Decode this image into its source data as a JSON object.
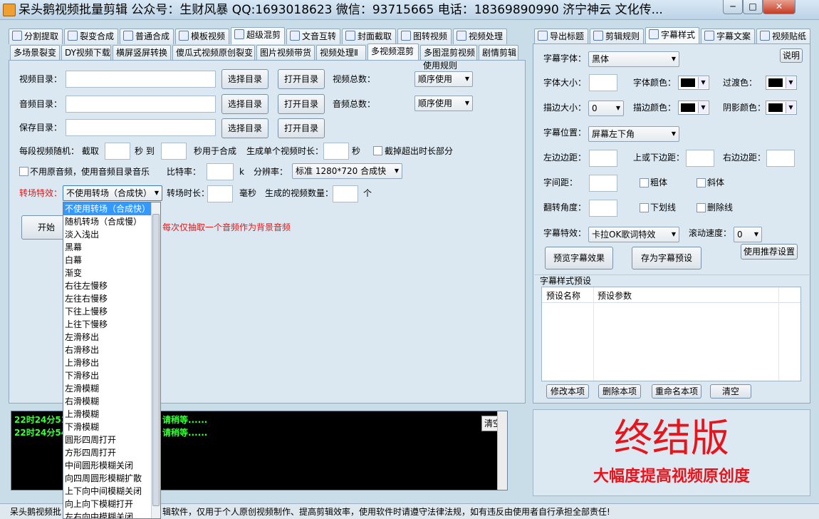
{
  "window": {
    "title": "呆头鹅视频批量剪辑 公众号：生财风暴 QQ:1693018623 微信：93715665 电话：18369890990 济宁神云 文化传...",
    "min_label": "─",
    "max_label": "□",
    "close_label": "✕"
  },
  "main_tabs": [
    "分割提取",
    "裂变合成",
    "普通合成",
    "模板视频",
    "超级混剪",
    "文音互转",
    "封面截取",
    "图转视频",
    "视频处理"
  ],
  "sub_tabs": [
    "多场景裂变",
    "DY视频下载",
    "横屏竖屏转换",
    "傻瓜式视频原创裂变",
    "图片视频带货",
    "视频处理Ⅱ",
    "多视频混剪",
    "多图混剪视频",
    "剧情剪辑"
  ],
  "form": {
    "usage_rule_label": "使用规则",
    "video_dir_label": "视频目录：",
    "audio_dir_label": "音频目录：",
    "save_dir_label": "保存目录：",
    "select_dir": "选择目录",
    "open_dir": "打开目录",
    "video_total_label": "视频总数：",
    "audio_total_label": "音频总数：",
    "video_order": "顺序使用",
    "audio_order": "顺序使用",
    "random_label": "每段视频随机： 截取",
    "sec_to": "秒 到",
    "sec_for_merge": "秒用于合成",
    "single_duration_label": "生成单个视频时长：",
    "sec": "秒",
    "cut_excess_label": "截掉超出时长部分",
    "no_original_audio": "不用原音频，使用音频目录音乐",
    "bitrate_label": "比特率：",
    "bitrate_unit": "k",
    "resolution_label": "分辨率：",
    "resolution_value": "标准 1280*720 合成快",
    "transition_label": "转场特效：",
    "transition_value": "不使用转场（合成快）",
    "transition_duration_label": "转场时长：",
    "ms": "毫秒",
    "gen_count_label": "生成的视频数量：",
    "unit_ge": "个",
    "start_btn": "开始",
    "hint_text": "每次仅抽取一个音频作为背景音频"
  },
  "transition_options": [
    "不使用转场（合成快）",
    "随机转场（合成慢）",
    "淡入浅出",
    "黑幕",
    "白幕",
    "渐变",
    "右往左慢移",
    "左往右慢移",
    "下往上慢移",
    "上往下慢移",
    "左滑移出",
    "右滑移出",
    "上滑移出",
    "下滑移出",
    "左滑模糊",
    "右滑模糊",
    "上滑模糊",
    "下滑模糊",
    "圆形四周打开",
    "方形四周打开",
    "中间圆形模糊关闭",
    "向四周圆形模糊扩散",
    "上下向中间模糊关闭",
    "向上向下模糊打开",
    "左右向中模糊关闭"
  ],
  "log": {
    "line1_time": "22时24分51",
    "line1_tail": "请稍等......",
    "line2_time": "22时24分54",
    "line2_tail": "请稍等......",
    "clear_btn": "清空"
  },
  "status": {
    "text": "呆头鹅视频批",
    "text_tail": "辑软件，仅用于个人原创视频制作、提高剪辑效率，使用软件时请遵守法律法规，如有违反由使用者自行承担全部责任!"
  },
  "right_tabs": [
    "导出标题",
    "剪辑规则",
    "字幕样式",
    "字幕文案",
    "视频贴纸"
  ],
  "subtitle": {
    "help_btn": "说明",
    "font_label": "字幕字体：",
    "font_value": "黑体",
    "size_label": "字体大小：",
    "font_color_label": "字体颜色：",
    "transition_color_label": "过渡色：",
    "stroke_size_label": "描边大小：",
    "stroke_size_value": "0",
    "stroke_color_label": "描边颜色：",
    "shadow_color_label": "阴影颜色：",
    "position_label": "字幕位置：",
    "position_value": "屏幕左下角",
    "left_margin_label": "左边边距：",
    "vert_margin_label": "上或下边距：",
    "right_margin_label": "右边边距：",
    "spacing_label": "字间距：",
    "bold_label": "粗体",
    "italic_label": "斜体",
    "rotate_label": "翻转角度：",
    "underline_label": "下划线",
    "strike_label": "删除线",
    "effect_label": "字幕特效：",
    "effect_value": "卡拉OK歌词特效",
    "scroll_label": "滚动速度：",
    "scroll_value": "0",
    "preview_btn": "预览字幕效果",
    "save_preset_btn": "存为字幕预设",
    "recommend_btn": "使用推荐设置",
    "preset_group": "字幕样式预设",
    "col_name": "预设名称",
    "col_params": "预设参数",
    "modify_btn": "修改本项",
    "delete_btn": "删除本项",
    "rename_btn": "重命名本项",
    "clear_btn": "清空"
  },
  "promo": {
    "title": "终结版",
    "subtitle": "大幅度提高视频原创度",
    "color": "#e8141c"
  }
}
